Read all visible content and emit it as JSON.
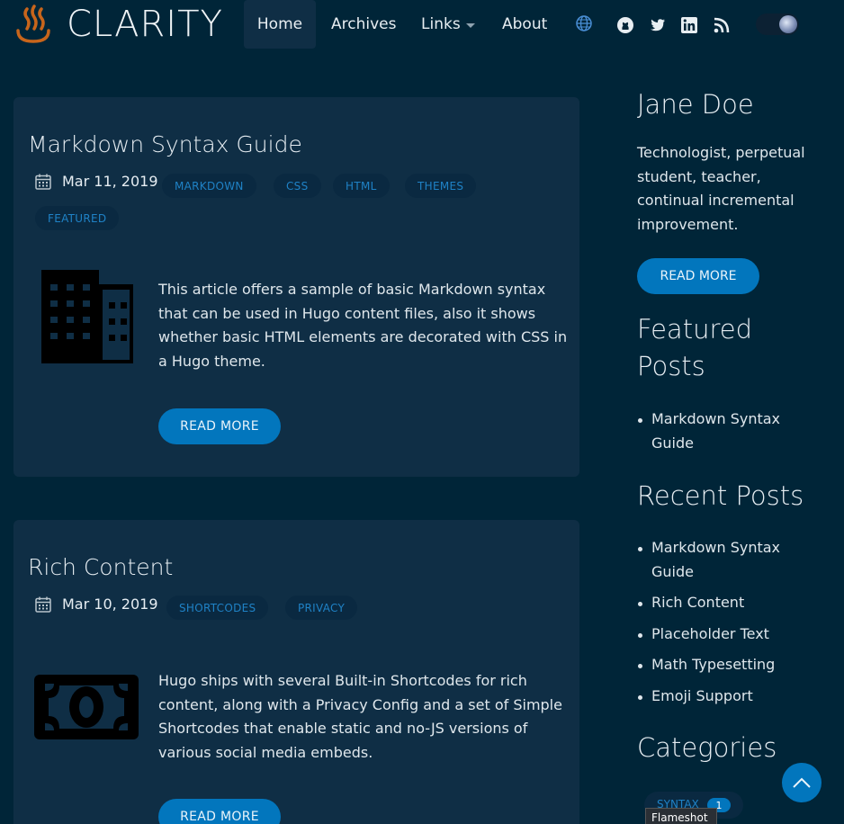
{
  "brand": {
    "name": "CLARITY"
  },
  "nav": {
    "home": "Home",
    "archives": "Archives",
    "links": "Links",
    "about": "About",
    "icons": [
      "globe-icon",
      "github-icon",
      "twitter-icon",
      "linkedin-icon",
      "rss-icon"
    ]
  },
  "posts": [
    {
      "title": "Markdown Syntax Guide",
      "date": "Mar 11, 2019",
      "tags": [
        "MARKDOWN",
        "CSS",
        "HTML",
        "THEMES",
        "FEATURED"
      ],
      "excerpt": "This article offers a sample of basic Markdown syntax that can be used in Hugo content files, also it shows whether basic HTML elements are decorated with CSS in a Hugo theme.",
      "button": "READ MORE",
      "thumb_icon": "building-icon"
    },
    {
      "title": "Rich Content",
      "date": "Mar 10, 2019",
      "tags": [
        "SHORTCODES",
        "PRIVACY"
      ],
      "excerpt": "Hugo ships with several Built-in Shortcodes for rich content, along with a Privacy Config and a set of Simple Shortcodes that enable static and no-JS versions of various social media embeds.",
      "button": "READ MORE",
      "thumb_icon": "money-icon"
    }
  ],
  "sidebar": {
    "author": {
      "name": "Jane Doe",
      "bio": "Technologist, perpetual student, teacher, continual incremental improvement.",
      "button": "READ MORE"
    },
    "featured": {
      "heading": "Featured Posts",
      "items": [
        "Markdown Syntax Guide"
      ]
    },
    "recent": {
      "heading": "Recent Posts",
      "items": [
        "Markdown Syntax Guide",
        "Rich Content",
        "Placeholder Text",
        "Math Typesetting",
        "Emoji Support"
      ]
    },
    "categories": {
      "heading": "Categories",
      "items": [
        {
          "label": "SYNTAX",
          "count": "1"
        }
      ]
    }
  },
  "tooltip": "Flameshot",
  "colors": {
    "background": "#002538",
    "card": "#0f2e45",
    "accent": "#0276bd",
    "tag_text": "#1f82c6"
  }
}
